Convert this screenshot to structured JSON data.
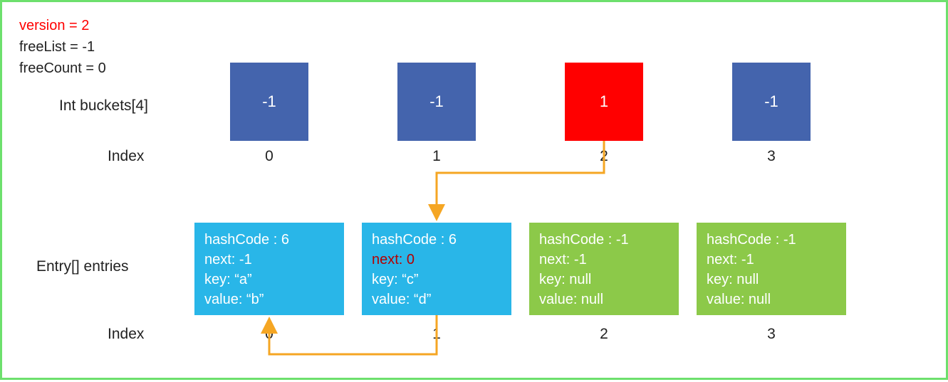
{
  "state": {
    "version_label": "version = 2",
    "freeList_label": "freeList = -1",
    "freeCount_label": "freeCount = 0"
  },
  "labels": {
    "buckets": "Int buckets[4]",
    "index": "Index",
    "entries": "Entry[] entries"
  },
  "buckets": [
    {
      "value": "-1",
      "color": "blue"
    },
    {
      "value": "-1",
      "color": "blue"
    },
    {
      "value": "1",
      "color": "red"
    },
    {
      "value": "-1",
      "color": "blue"
    }
  ],
  "bucket_indices": [
    "0",
    "1",
    "2",
    "3"
  ],
  "entries": [
    {
      "hashCode": "hashCode : 6",
      "next": "next: -1",
      "next_highlight": false,
      "key": "key: “a”",
      "value": "value: “b”",
      "color": "cyan"
    },
    {
      "hashCode": "hashCode : 6",
      "next": "next: 0",
      "next_highlight": true,
      "key": "key: “c”",
      "value": "value: “d”",
      "color": "cyan"
    },
    {
      "hashCode": "hashCode : -1",
      "next": "next: -1",
      "next_highlight": false,
      "key": "key: null",
      "value": "value: null",
      "color": "green"
    },
    {
      "hashCode": "hashCode : -1",
      "next": "next: -1",
      "next_highlight": false,
      "key": "key: null",
      "value": "value: null",
      "color": "green"
    }
  ],
  "entry_indices": [
    "0",
    "1",
    "2",
    "3"
  ],
  "arrows": {
    "bucket_to_entry": {
      "from_bucket": 2,
      "to_entry": 1
    },
    "entry_to_entry": {
      "from_entry": 1,
      "to_entry": 0
    }
  },
  "colors": {
    "border": "#6de06d",
    "blue": "#4464ad",
    "red": "#ff0000",
    "cyan": "#29b6e8",
    "green": "#8cc949",
    "arrow": "#f5a623"
  }
}
